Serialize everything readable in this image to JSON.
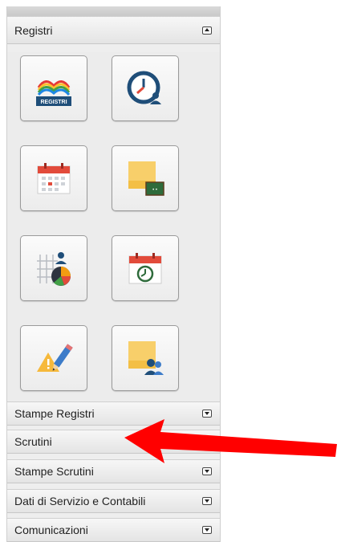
{
  "sections": {
    "registri": {
      "label": "Registri",
      "state": "expanded",
      "icon": "collapse-icon"
    },
    "stampe_registri": {
      "label": "Stampe Registri",
      "icon": "expand-icon"
    },
    "scrutini": {
      "label": "Scrutini",
      "icon": "expand-icon"
    },
    "stampe_scrutini": {
      "label": "Stampe Scrutini",
      "icon": "expand-icon"
    },
    "dati_servizio": {
      "label": "Dati di Servizio e Contabili",
      "icon": "expand-icon"
    },
    "comunicazioni": {
      "label": "Comunicazioni",
      "icon": "expand-icon"
    }
  },
  "tiles": [
    {
      "icon": "registri-book-icon",
      "caption": "REGISTRI"
    },
    {
      "icon": "clock-user-icon"
    },
    {
      "icon": "calendar-icon"
    },
    {
      "icon": "sticky-note-blackboard-icon"
    },
    {
      "icon": "grid-user-pie-chart-icon"
    },
    {
      "icon": "calendar-clock-icon"
    },
    {
      "icon": "warning-pencil-icon"
    },
    {
      "icon": "sticky-note-users-icon"
    }
  ],
  "annotation": {
    "icon": "red-arrow-icon",
    "color": "#ff0000"
  },
  "colors": {
    "accent_blue": "#1f4e79",
    "calendar_red": "#e24b3b",
    "note_yellow": "#f8cf6a",
    "board_green": "#2e6b3b"
  }
}
